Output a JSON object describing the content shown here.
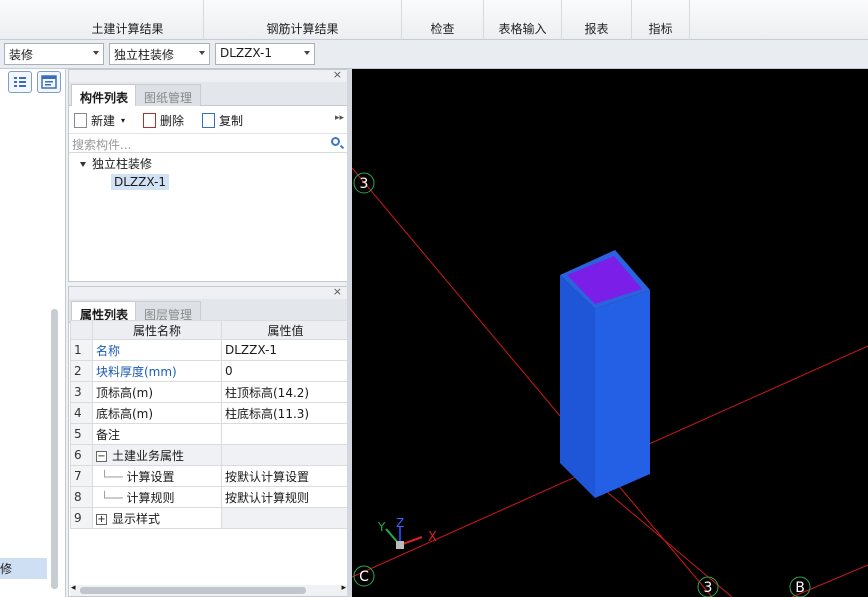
{
  "ribbon": {
    "tabs": [
      "土建计算结果",
      "钢筋计算结果",
      "检查",
      "表格输入",
      "报表",
      "指标"
    ]
  },
  "toolbar": {
    "combo_floor": "装修",
    "combo_type": "独立柱装修",
    "combo_item": "DLZZX-1"
  },
  "leftnav": {
    "selected_label": "修"
  },
  "component_panel": {
    "tab_active": "构件列表",
    "tab_inactive": "图纸管理",
    "new_label": "新建",
    "delete_label": "删除",
    "copy_label": "复制",
    "search_placeholder": "搜索构件...",
    "tree_group": "独立柱装修",
    "tree_item": "DLZZX-1"
  },
  "property_panel": {
    "tab_active": "属性列表",
    "tab_inactive": "图层管理",
    "col_name": "属性名称",
    "col_value": "属性值",
    "rows": [
      {
        "no": "1",
        "name": "名称",
        "value": "DLZZX-1"
      },
      {
        "no": "2",
        "name": "块料厚度(mm)",
        "value": "0"
      },
      {
        "no": "3",
        "name": "顶标高(m)",
        "value": "柱顶标高(14.2)"
      },
      {
        "no": "4",
        "name": "底标高(m)",
        "value": "柱底标高(11.3)"
      },
      {
        "no": "5",
        "name": "备注",
        "value": ""
      },
      {
        "no": "6",
        "name": "土建业务属性",
        "value": ""
      },
      {
        "no": "7",
        "name": "计算设置",
        "value": "按默认计算设置"
      },
      {
        "no": "8",
        "name": "计算规则",
        "value": "按默认计算规则"
      },
      {
        "no": "9",
        "name": "显示样式",
        "value": ""
      }
    ],
    "expand_minus": "−",
    "expand_plus": "+"
  },
  "viewport": {
    "axis_labels": {
      "a": "3",
      "b": "C",
      "c": "3",
      "d": "B"
    },
    "gizmo": {
      "x": "X",
      "y": "Y",
      "z": "Z"
    },
    "colors": {
      "background": "#000000",
      "grid_line": "#d01818",
      "column_side": "#1f56d8",
      "column_top": "#7a1ee8"
    }
  },
  "panel_close": "×"
}
